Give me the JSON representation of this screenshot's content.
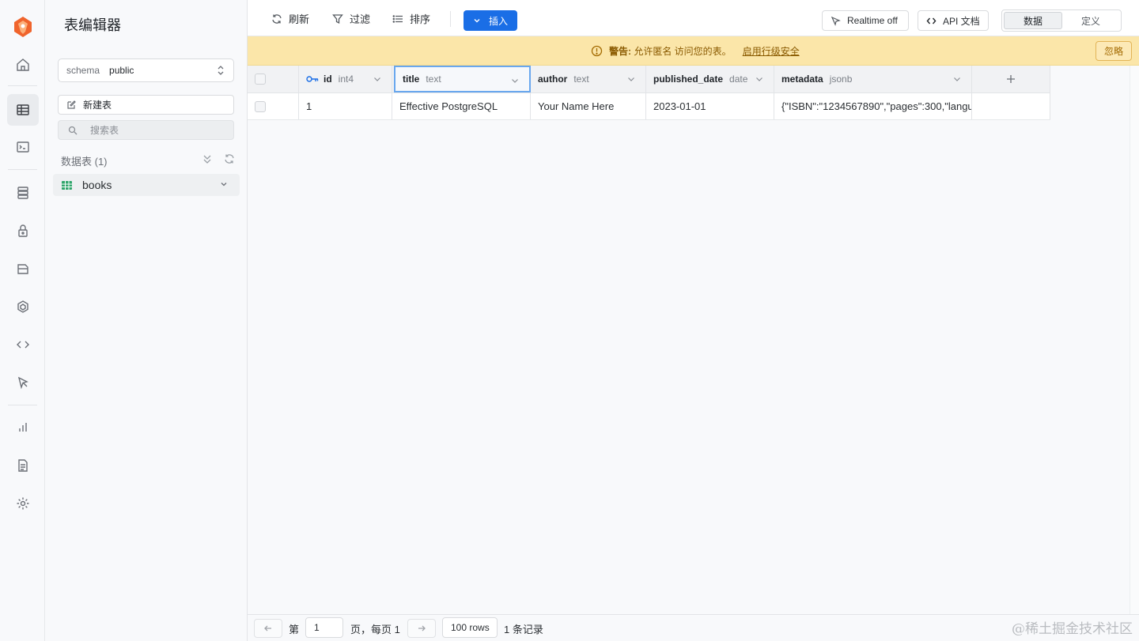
{
  "sidebar": {
    "title": "表编辑器",
    "schema_key": "schema",
    "schema_value": "public",
    "new_table": "新建表",
    "search_placeholder": "搜索表",
    "section_label": "数据表 (1)",
    "tables": [
      {
        "name": "books"
      }
    ]
  },
  "toolbar": {
    "refresh": "刷新",
    "filter": "过滤",
    "sort": "排序",
    "insert": "插入",
    "realtime": "Realtime off",
    "api_docs": "API 文档",
    "view_data": "数据",
    "view_definition": "定义"
  },
  "banner": {
    "prefix": "警告:",
    "message": "允许匿名 访问您的表。",
    "link": "启用行级安全",
    "ignore": "忽略"
  },
  "grid": {
    "columns": [
      {
        "name": "id",
        "type": "int4"
      },
      {
        "name": "title",
        "type": "text"
      },
      {
        "name": "author",
        "type": "text"
      },
      {
        "name": "published_date",
        "type": "date"
      },
      {
        "name": "metadata",
        "type": "jsonb"
      }
    ],
    "rows": [
      {
        "id": "1",
        "title": "Effective PostgreSQL",
        "author": "Your Name Here",
        "published_date": "2023-01-01",
        "metadata": "{\"ISBN\":\"1234567890\",\"pages\":300,\"langu"
      }
    ]
  },
  "footer": {
    "page_prefix": "第",
    "page_value": "1",
    "page_suffix": "页，每页 1",
    "rows_per_page": "100 rows",
    "record_count": "1 条记录"
  },
  "watermark": "@稀土掘金技术社区",
  "colors": {
    "accent": "#1a6ee6",
    "warning_bg": "#fbe6a9",
    "logo": "#f0642c"
  }
}
